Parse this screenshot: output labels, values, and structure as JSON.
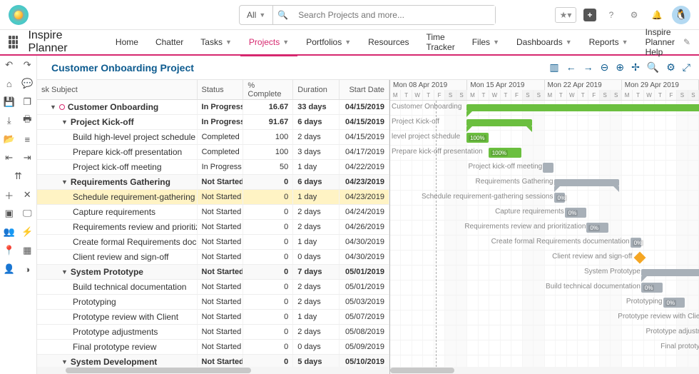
{
  "search": {
    "filter": "All",
    "placeholder": "Search Projects and more..."
  },
  "app_name": "Inspire Planner",
  "nav": [
    "Home",
    "Chatter",
    "Tasks",
    "Projects",
    "Portfolios",
    "Resources",
    "Time Tracker",
    "Files",
    "Dashboards",
    "Reports",
    "Inspire Planner Help"
  ],
  "nav_dropdown": [
    false,
    false,
    true,
    true,
    true,
    false,
    false,
    true,
    true,
    true,
    false
  ],
  "nav_active": 3,
  "page_title": "Customer Onboarding Project",
  "columns": {
    "task": "sk Subject",
    "status": "Status",
    "pct": "% Complete",
    "dur": "Duration",
    "start": "Start Date"
  },
  "weeks": [
    "Mon 08 Apr 2019",
    "Mon 15 Apr 2019",
    "Mon 22 Apr 2019",
    "Mon 29 Apr 2019"
  ],
  "days": [
    "M",
    "T",
    "W",
    "T",
    "F",
    "S",
    "S"
  ],
  "rows": [
    {
      "indent": 1,
      "caret": "▼",
      "dot": true,
      "task": "Customer Onboarding",
      "status": "In Progress",
      "pct": "16.67",
      "dur": "33 days",
      "start": "04/15/2019",
      "bold": true
    },
    {
      "indent": 2,
      "caret": "▼",
      "task": "Project Kick-off",
      "status": "In Progress",
      "pct": "91.67",
      "dur": "6 days",
      "start": "04/15/2019",
      "bold": true
    },
    {
      "indent": 3,
      "task": "Build high-level project schedule",
      "status": "Completed",
      "status_green": true,
      "pct": "100",
      "dur": "2 days",
      "start": "04/15/2019"
    },
    {
      "indent": 3,
      "task": "Prepare kick-off presentation",
      "status": "Completed",
      "status_green": true,
      "pct": "100",
      "dur": "3 days",
      "start": "04/17/2019"
    },
    {
      "indent": 3,
      "task": "Project kick-off meeting",
      "status": "In Progress",
      "pct": "50",
      "dur": "1 day",
      "start": "04/22/2019"
    },
    {
      "indent": 2,
      "caret": "▼",
      "task": "Requirements Gathering",
      "status": "Not Started",
      "pct": "0",
      "dur": "6 days",
      "start": "04/23/2019",
      "bold": true,
      "section": true
    },
    {
      "indent": 3,
      "task": "Schedule requirement-gathering sessions",
      "status": "Not Started",
      "pct": "0",
      "dur": "1 day",
      "start": "04/23/2019",
      "hl": true
    },
    {
      "indent": 3,
      "task": "Capture requirements",
      "status": "Not Started",
      "pct": "0",
      "dur": "2 days",
      "start": "04/24/2019"
    },
    {
      "indent": 3,
      "task": "Requirements review and prioritization",
      "status": "Not Started",
      "pct": "0",
      "dur": "2 days",
      "start": "04/26/2019"
    },
    {
      "indent": 3,
      "task": "Create formal Requirements documentation",
      "status": "Not Started",
      "pct": "0",
      "dur": "1 day",
      "start": "04/30/2019"
    },
    {
      "indent": 3,
      "task": "Client review and sign-off",
      "status": "Not Started",
      "pct": "0",
      "dur": "0 days",
      "start": "04/30/2019"
    },
    {
      "indent": 2,
      "caret": "▼",
      "task": "System Prototype",
      "status": "Not Started",
      "pct": "0",
      "dur": "7 days",
      "start": "05/01/2019",
      "bold": true,
      "section": true
    },
    {
      "indent": 3,
      "task": "Build technical documentation",
      "status": "Not Started",
      "pct": "0",
      "dur": "2 days",
      "start": "05/01/2019"
    },
    {
      "indent": 3,
      "task": "Prototyping",
      "status": "Not Started",
      "pct": "0",
      "dur": "2 days",
      "start": "05/03/2019"
    },
    {
      "indent": 3,
      "task": "Prototype review with Client",
      "status": "Not Started",
      "pct": "0",
      "dur": "1 day",
      "start": "05/07/2019"
    },
    {
      "indent": 3,
      "task": "Prototype adjustments",
      "status": "Not Started",
      "pct": "0",
      "dur": "2 days",
      "start": "05/08/2019"
    },
    {
      "indent": 3,
      "task": "Final prototype review",
      "status": "Not Started",
      "pct": "0",
      "dur": "0 days",
      "start": "05/09/2019"
    },
    {
      "indent": 2,
      "caret": "▼",
      "task": "System Development",
      "status": "Not Started",
      "pct": "0",
      "dur": "5 days",
      "start": "05/10/2019",
      "bold": true,
      "section": true
    }
  ],
  "gantt_labels": [
    "Customer Onboarding",
    "Project Kick-off",
    "level project schedule",
    "Prepare kick-off presentation",
    "Project kick-off meeting",
    "Requirements Gathering",
    "Schedule requirement-gathering sessions",
    "Capture requirements",
    "Requirements review and prioritization",
    "Create formal Requirements documentation",
    "Client review and sign-off",
    "System Prototype",
    "Build technical documentation",
    "Prototyping",
    "Prototype review with Client",
    "Prototype adjustments",
    "Final prototype review"
  ]
}
